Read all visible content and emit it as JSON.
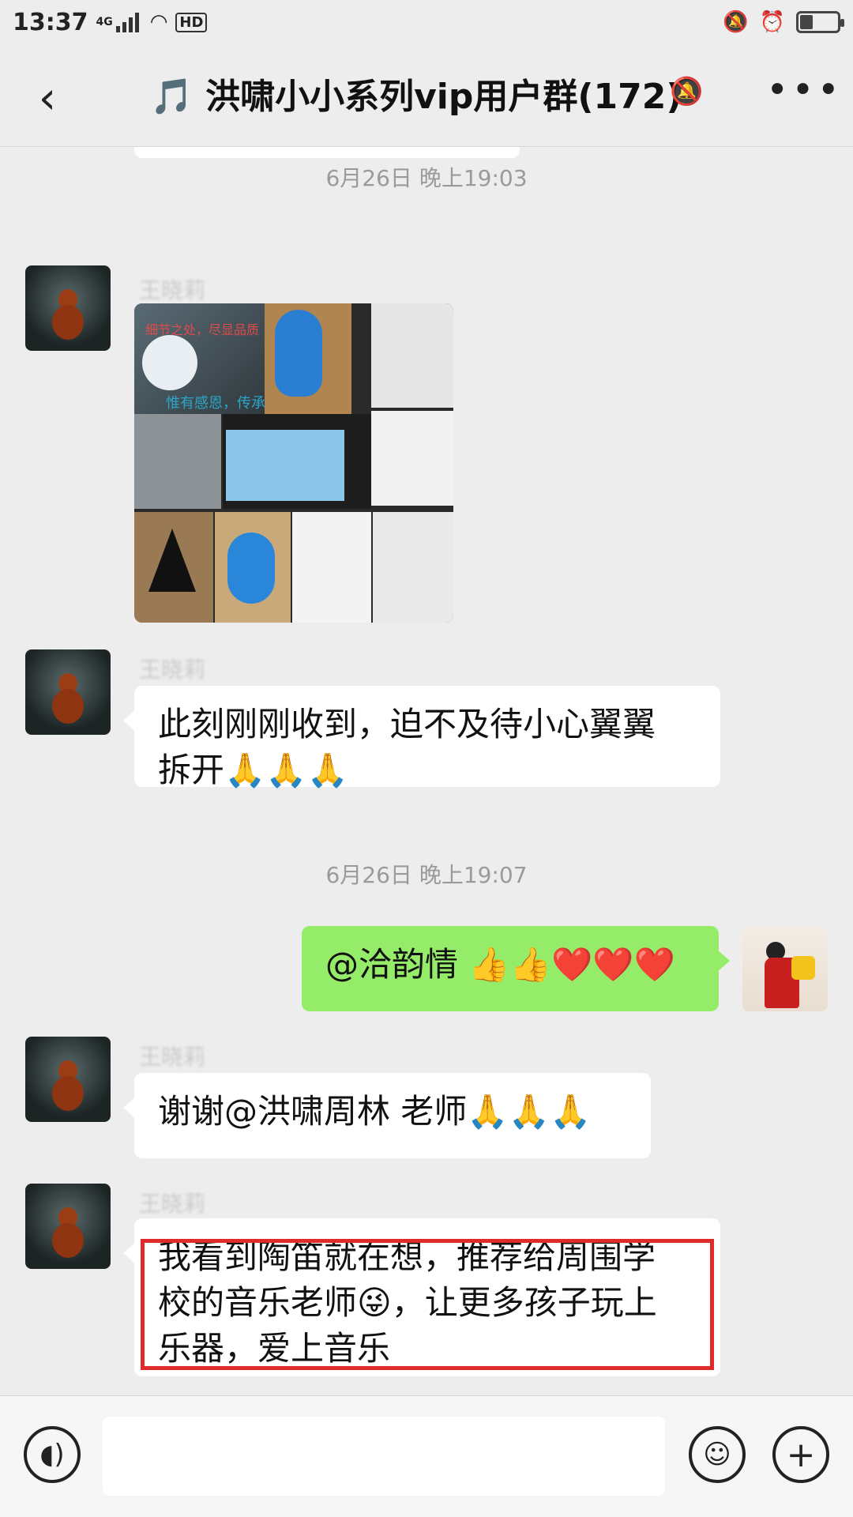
{
  "status": {
    "time": "13:37",
    "network": "4G",
    "hd": "HD",
    "battery_level": 0.35
  },
  "header": {
    "title": "🎵 洪啸小小系列vip用户群(172)",
    "back_icon": "back-arrow-icon",
    "mute_icon": "bell-muted-icon",
    "more_icon": "more-dots-icon"
  },
  "messages": {
    "stamp1": "6月26日 晚上19:03",
    "stamp2": "6月26日 晚上19:07",
    "sender_name": "王晓莉",
    "m2_line1": "此刻刚刚收到，迫不及待小心翼翼",
    "m2_line2": "拆开🙏🙏🙏",
    "m3": "@洽韵情 👍👍❤️❤️❤️",
    "m4": "谢谢@洪啸周林  老师🙏🙏🙏",
    "m5_line1": "我看到陶笛就在想，推荐给周围学",
    "m5_line2": "校的音乐老师😜，让更多孩子玩上",
    "m5_line3": "乐器，爱上音乐"
  },
  "photo_text": {
    "line1": "细节之处，尽显品质",
    "line2": "惟有感恩，传承"
  },
  "inputbar": {
    "voice_icon": "voice-icon",
    "emoji_icon": "emoji-icon",
    "plus_icon": "plus-icon"
  },
  "colors": {
    "my_bubble": "#95ec69",
    "highlight": "#e02b2b"
  }
}
